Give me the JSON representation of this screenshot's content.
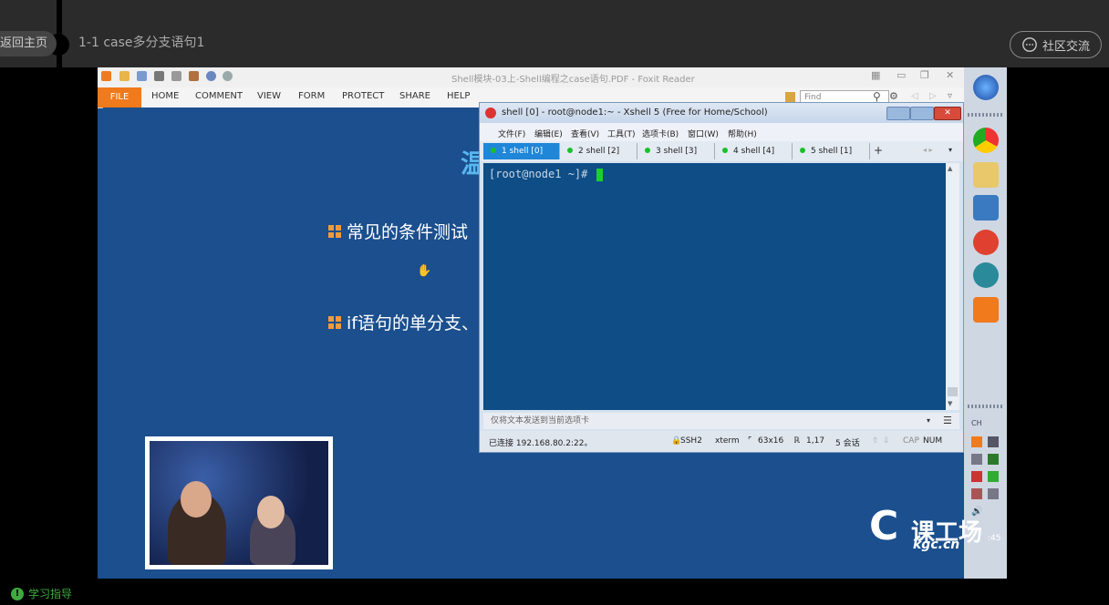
{
  "header": {
    "back_label": "返回主页",
    "lesson_title": "1-1 case多分支语句1",
    "community_label": "社区交流"
  },
  "foxit": {
    "window_title": "Shell模块-03上-Shell编程之case语句.PDF - Foxit Reader",
    "ribbon_tabs": [
      "FILE",
      "HOME",
      "COMMENT",
      "VIEW",
      "FORM",
      "PROTECT",
      "SHARE",
      "HELP"
    ],
    "find_placeholder": "Find"
  },
  "slide": {
    "heading_fragment": "温",
    "bullets": [
      "常见的条件测试",
      "if语句的单分支、"
    ]
  },
  "xshell": {
    "window_title": "shell [0] - root@node1:~ - Xshell 5 (Free for Home/School)",
    "menu": [
      "文件(F)",
      "编辑(E)",
      "查看(V)",
      "工具(T)",
      "选项卡(B)",
      "窗口(W)",
      "帮助(H)"
    ],
    "tabs": [
      {
        "num": "1",
        "label": "shell [0]",
        "active": true
      },
      {
        "num": "2",
        "label": "shell [2]",
        "active": false
      },
      {
        "num": "3",
        "label": "shell [3]",
        "active": false
      },
      {
        "num": "4",
        "label": "shell [4]",
        "active": false
      },
      {
        "num": "5",
        "label": "shell [1]",
        "active": false
      }
    ],
    "prompt": "[root@node1 ~]# ",
    "input_hint": "仅将文本发送到当前选项卡",
    "status": {
      "connection": "已连接 192.168.80.2:22。",
      "protocol": "SSH2",
      "terminal": "xterm",
      "size": "63x16",
      "cursor": "1,17",
      "sessions": "5 会话",
      "cap": "CAP",
      "num": "NUM"
    }
  },
  "taskbar": {
    "clock_fragment": ":45",
    "ime": "CH"
  },
  "watermark": {
    "cn": "课工场",
    "en": "kgc.cn"
  },
  "footer": {
    "guide_label": "学习指导"
  }
}
